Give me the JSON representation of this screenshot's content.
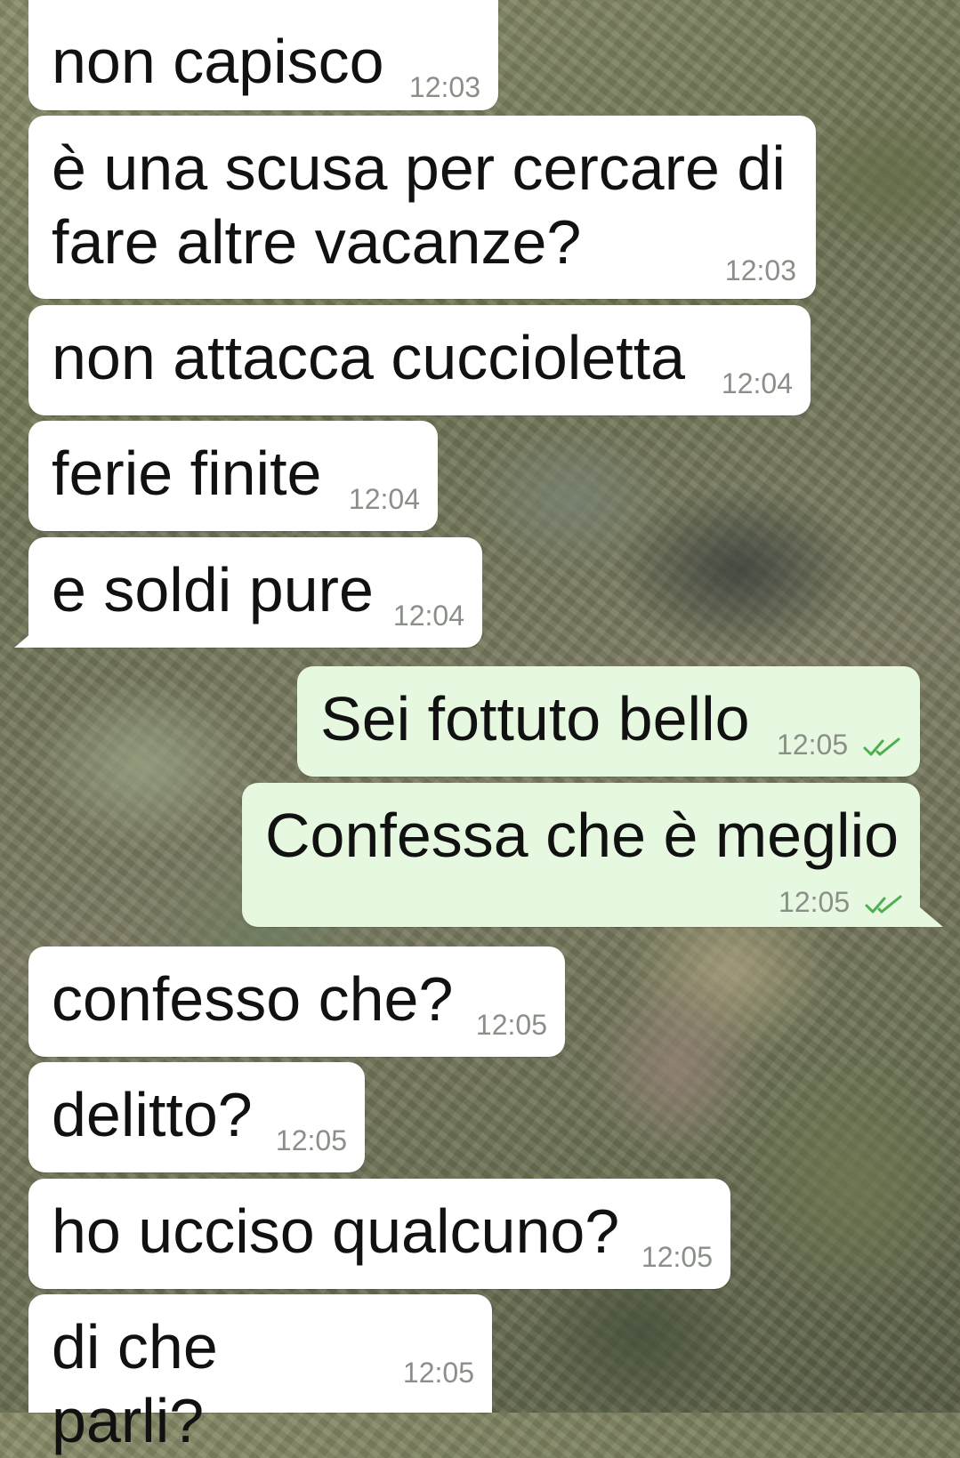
{
  "messages": [
    {
      "text": "non capisco",
      "time": "12:03",
      "direction": "in"
    },
    {
      "text": "è una scusa per cercare di fare altre vacanze?",
      "time": "12:03",
      "direction": "in"
    },
    {
      "text": "non attacca cuccioletta",
      "time": "12:04",
      "direction": "in"
    },
    {
      "text": "ferie finite",
      "time": "12:04",
      "direction": "in"
    },
    {
      "text": "e soldi pure",
      "time": "12:04",
      "direction": "in"
    },
    {
      "text": "Sei fottuto bello",
      "time": "12:05",
      "direction": "out",
      "status": "read-double-check-icon"
    },
    {
      "text": "Confessa che è meglio",
      "time": "12:05",
      "direction": "out",
      "status": "read-double-check-icon"
    },
    {
      "text": "confesso che?",
      "time": "12:05",
      "direction": "in"
    },
    {
      "text": "delitto?",
      "time": "12:05",
      "direction": "in"
    },
    {
      "text": "ho ucciso qualcuno?",
      "time": "12:05",
      "direction": "in"
    },
    {
      "text": "di che parli?",
      "time": "12:05",
      "direction": "in"
    }
  ],
  "colors": {
    "incoming_bubble": "#ffffff",
    "outgoing_bubble": "#e7f8e1",
    "timestamp": "#8a9088",
    "read_ticks": "#4fae4e"
  }
}
